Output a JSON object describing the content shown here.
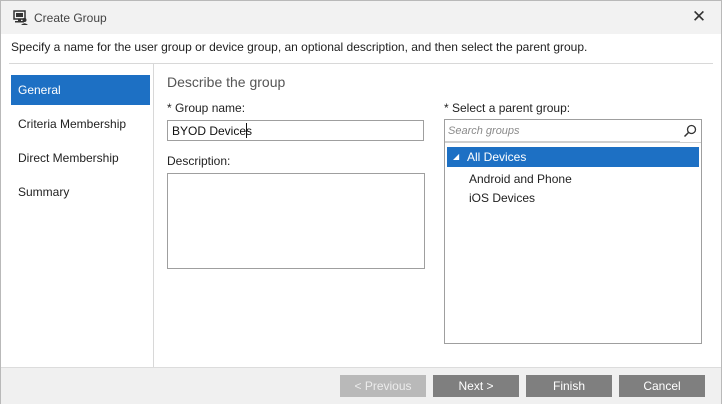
{
  "window": {
    "title": "Create Group",
    "close_glyph": "✕"
  },
  "instructions": "Specify a name for the user group or device group, an optional description, and then select the parent group.",
  "nav": {
    "items": [
      {
        "label": "General",
        "active": true
      },
      {
        "label": "Criteria Membership"
      },
      {
        "label": "Direct Membership"
      },
      {
        "label": "Summary"
      }
    ]
  },
  "form": {
    "section_title": "Describe the group",
    "group_name_label": "* Group name:",
    "group_name_value": "BYOD Devices",
    "description_label": "Description:",
    "parent_group_label": "* Select a parent group:",
    "search_placeholder": "Search groups"
  },
  "tree": {
    "nodes": [
      {
        "label": "All Devices",
        "expanded": true,
        "selected": true
      },
      {
        "label": "Android and Phone"
      },
      {
        "label": "iOS Devices"
      }
    ],
    "expander_glyph": "◢"
  },
  "footer": {
    "previous_label": "< Previous",
    "next_label": "Next >",
    "finish_label": "Finish",
    "cancel_label": "Cancel"
  },
  "colors": {
    "accent": "#1d70c4",
    "button": "#7f7f7f",
    "button_disabled": "#b9b9b9"
  }
}
